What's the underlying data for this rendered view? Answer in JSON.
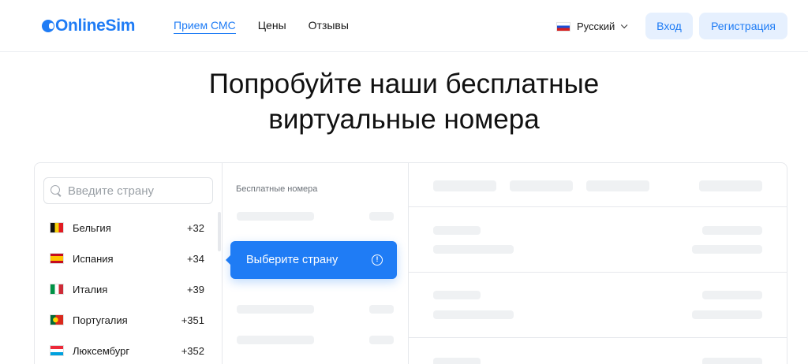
{
  "header": {
    "logo_text": "OnlineSim",
    "nav": [
      {
        "label": "Прием СМС",
        "active": true
      },
      {
        "label": "Цены",
        "active": false
      },
      {
        "label": "Отзывы",
        "active": false
      }
    ],
    "language": "Русский",
    "login_label": "Вход",
    "register_label": "Регистрация"
  },
  "hero": {
    "line1": "Попробуйте наши бесплатные",
    "line2": "виртуальные номера"
  },
  "search": {
    "placeholder": "Введите страну"
  },
  "countries": [
    {
      "name": "Бельгия",
      "code": "+32",
      "flag": "belgium-flag"
    },
    {
      "name": "Испания",
      "code": "+34",
      "flag": "spain-flag"
    },
    {
      "name": "Италия",
      "code": "+39",
      "flag": "italy-flag"
    },
    {
      "name": "Португалия",
      "code": "+351",
      "flag": "portugal-flag"
    },
    {
      "name": "Люксембург",
      "code": "+352",
      "flag": "luxembourg-flag"
    }
  ],
  "numbers_panel": {
    "title": "Бесплатные номера"
  },
  "tooltip": {
    "text": "Выберите страну",
    "icon": "info-icon"
  },
  "colors": {
    "accent": "#1f7cf5",
    "button_bg": "#e6f0fe",
    "skeleton": "#eff1f3"
  }
}
